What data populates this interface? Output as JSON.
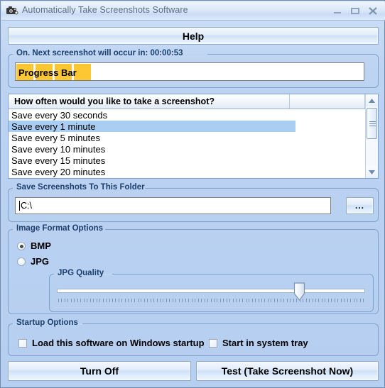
{
  "window": {
    "title": "Automatically Take Screenshots Software",
    "icon": "camera-icon",
    "minimize_label": "–",
    "maximize_label": "▭",
    "close_label": "X"
  },
  "toolbar": {
    "help_label": "Help"
  },
  "status_group": {
    "legend": "On. Next screenshot will occur in: 00:00:53",
    "progress_text": "Progress Bar",
    "progress_chunks": 4,
    "progress_chunk_color": "#fcc732"
  },
  "schedule_list": {
    "header": "How often would you like to take a screenshot?",
    "header_col2": "",
    "selected_index": 1,
    "selection_color": "#aacdf4",
    "items": [
      "Save every 30 seconds",
      "Save every 1 minute",
      "Save every 5 minutes",
      "Save every 10 minutes",
      "Save every 15 minutes",
      "Save every 20 minutes"
    ]
  },
  "folder_group": {
    "legend": "Save Screenshots To This Folder",
    "path_value": "C:\\",
    "path_placeholder": "",
    "browse_label": "..."
  },
  "format_group": {
    "legend": "Image Format Options",
    "options": [
      {
        "label": "BMP",
        "selected": true
      },
      {
        "label": "JPG",
        "selected": false
      }
    ],
    "quality": {
      "legend": "JPG Quality",
      "value": 78,
      "min": 0,
      "max": 100
    }
  },
  "startup_group": {
    "legend": "Startup Options",
    "checkboxes": [
      {
        "label": "Load this software on Windows startup",
        "checked": false
      },
      {
        "label": "Start in system tray",
        "checked": false
      }
    ]
  },
  "actions": {
    "turn_off_label": "Turn Off",
    "test_label": "Test (Take Screenshot Now)"
  },
  "theme": {
    "background": "#b6cef0",
    "border": "#7ea2cf",
    "legend_text": "#1c3f6e"
  }
}
